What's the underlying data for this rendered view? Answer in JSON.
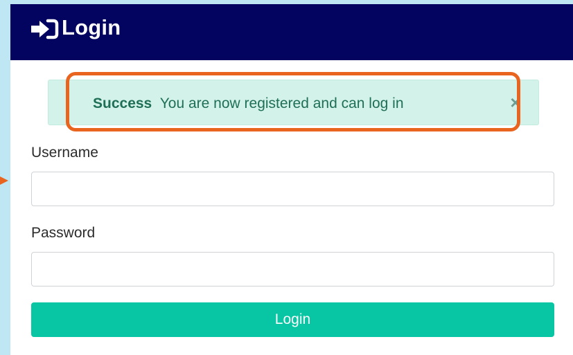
{
  "header": {
    "title": "Login",
    "icon": "sign-in-icon",
    "background": "#03045f"
  },
  "alert": {
    "strong": "Success",
    "message": "You are now registered and can log in",
    "close_label": "×",
    "background": "#d3f3ea",
    "text_color": "#1f6e56"
  },
  "highlight": {
    "color": "#e8641f"
  },
  "form": {
    "username_label": "Username",
    "username_value": "",
    "username_placeholder": "",
    "password_label": "Password",
    "password_value": "",
    "password_placeholder": "",
    "submit_label": "Login",
    "submit_color": "#08c6a3"
  }
}
